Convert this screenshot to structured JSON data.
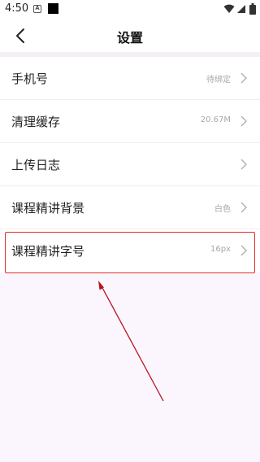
{
  "status_bar": {
    "time": "4:50",
    "notification_glyph": "A"
  },
  "header": {
    "title": "设置"
  },
  "settings": [
    {
      "label": "手机号",
      "value": "待绑定"
    },
    {
      "label": "清理缓存",
      "value": "20.67M"
    },
    {
      "label": "上传日志",
      "value": ""
    },
    {
      "label": "课程精讲背景",
      "value": "白色"
    },
    {
      "label": "课程精讲字号",
      "value": "16px"
    }
  ],
  "colors": {
    "highlight": "#e0302a",
    "annotation_arrow": "#b5141f",
    "page_background": "#fbf6fd"
  }
}
